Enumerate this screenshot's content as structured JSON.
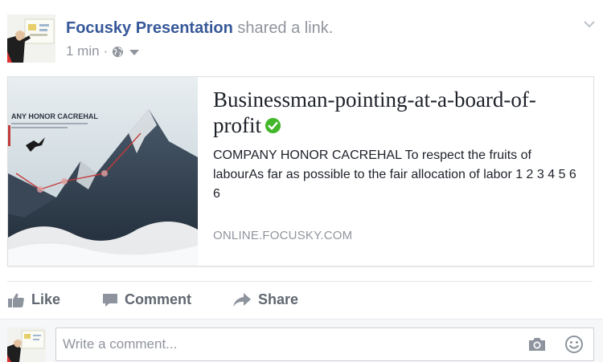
{
  "post": {
    "author": "Focusky Presentation",
    "action": "shared a link.",
    "time": "1 min",
    "separator": "·",
    "privacy_icon": "globe-icon",
    "menu_icon": "chevron-down-icon"
  },
  "link_card": {
    "image_caption": "ANY HONOR CACREHAL",
    "title": "Businessman-pointing-at-a-board-of-profit",
    "verified_icon": "check-circle-icon",
    "description": "COMPANY HONOR CACREHAL To respect the fruits of labourAs far as possible to the fair allocation of labor 1 2 3 4 5 6 6",
    "domain": "ONLINE.FOCUSKY.COM"
  },
  "actions": {
    "like": "Like",
    "comment": "Comment",
    "share": "Share"
  },
  "comment_box": {
    "placeholder": "Write a comment...",
    "camera_icon": "camera-icon",
    "emoji_icon": "smiley-icon"
  },
  "colors": {
    "author_link": "#365899",
    "muted_text": "#90949c",
    "action_text": "#606770",
    "verified_green": "#42b72a"
  }
}
